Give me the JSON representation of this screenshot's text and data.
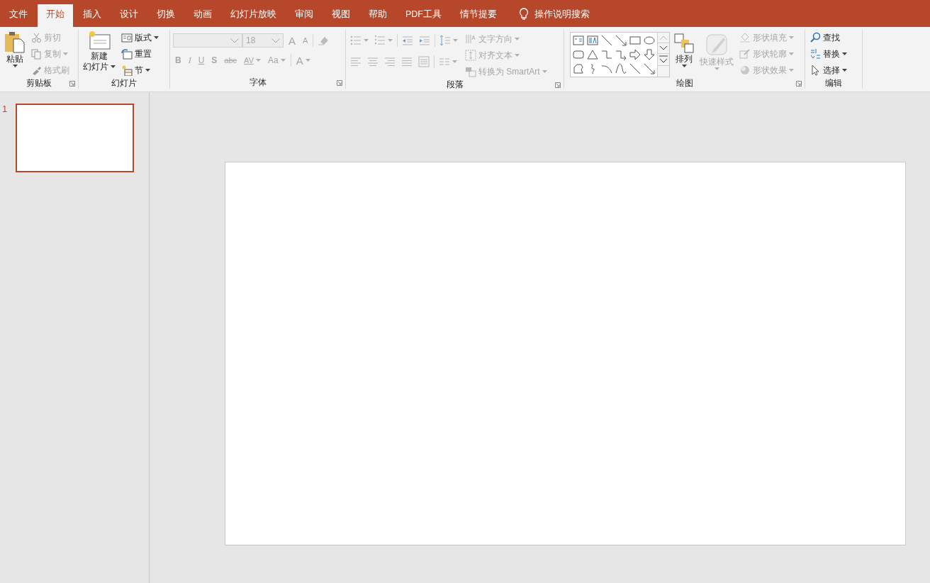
{
  "tabs": [
    {
      "label": "文件",
      "selected": false
    },
    {
      "label": "开始",
      "selected": true
    },
    {
      "label": "插入",
      "selected": false
    },
    {
      "label": "设计",
      "selected": false
    },
    {
      "label": "切换",
      "selected": false
    },
    {
      "label": "动画",
      "selected": false
    },
    {
      "label": "幻灯片放映",
      "selected": false
    },
    {
      "label": "审阅",
      "selected": false
    },
    {
      "label": "视图",
      "selected": false
    },
    {
      "label": "帮助",
      "selected": false
    },
    {
      "label": "PDF工具",
      "selected": false
    },
    {
      "label": "情节提要",
      "selected": false
    }
  ],
  "tell_me": {
    "placeholder": "操作说明搜索"
  },
  "clipboard": {
    "label": "剪贴板",
    "launcher": true,
    "paste": {
      "label": "粘贴",
      "disabled": false
    },
    "small": [
      {
        "label": "剪切",
        "dropdown": false,
        "disabled": true
      },
      {
        "label": "复制",
        "dropdown": true,
        "disabled": true
      },
      {
        "label": "格式刷",
        "dropdown": false,
        "disabled": true
      }
    ]
  },
  "slides": {
    "label": "幻灯片",
    "launcher": false,
    "new_slide": {
      "lines": [
        "新建",
        "幻灯片"
      ],
      "disabled": false
    },
    "small": [
      {
        "label": "版式",
        "dropdown": true,
        "disabled": false
      },
      {
        "label": "重置",
        "dropdown": false,
        "disabled": false
      },
      {
        "label": "节",
        "dropdown": true,
        "disabled": false
      }
    ]
  },
  "font": {
    "label": "字体",
    "launcher": true,
    "disabled": true,
    "font_size": {
      "value": "18"
    },
    "row1_glyphs": [
      {
        "text": "A"
      },
      {
        "text": "A"
      }
    ],
    "row2_glyphs": [
      {
        "text": "B",
        "dropdown": false
      },
      {
        "text": "I",
        "dropdown": false
      },
      {
        "text": "U",
        "dropdown": false
      },
      {
        "text": "S",
        "dropdown": false
      },
      {
        "text": "abc",
        "dropdown": false
      },
      {
        "text": "AV",
        "dropdown": true
      },
      {
        "text": "Aa",
        "dropdown": true
      },
      {
        "text": "A",
        "dropdown": true
      }
    ]
  },
  "paragraph": {
    "label": "段落",
    "launcher": true,
    "disabled": true,
    "right": [
      {
        "label": "文字方向",
        "dropdown": true
      },
      {
        "label": "对齐文本",
        "dropdown": true
      },
      {
        "label": "转换为 SmartArt",
        "dropdown": true
      }
    ]
  },
  "drawing": {
    "label": "绘图",
    "launcher": true,
    "arrange": {
      "label": "排列",
      "disabled": false
    },
    "quick_styles": {
      "label": "快速样式",
      "disabled": true
    },
    "small": [
      {
        "label": "形状填充",
        "dropdown": true,
        "disabled": true
      },
      {
        "label": "形状轮廓",
        "dropdown": true,
        "disabled": true
      },
      {
        "label": "形状效果",
        "dropdown": true,
        "disabled": true
      }
    ]
  },
  "editing": {
    "label": "编辑",
    "launcher": false,
    "small": [
      {
        "label": "查找",
        "dropdown": false,
        "disabled": false
      },
      {
        "label": "替换",
        "dropdown": true,
        "disabled": false
      },
      {
        "label": "选择",
        "dropdown": true,
        "disabled": false
      }
    ]
  },
  "thumbnails": [
    {
      "number": "1",
      "selected": true
    }
  ]
}
